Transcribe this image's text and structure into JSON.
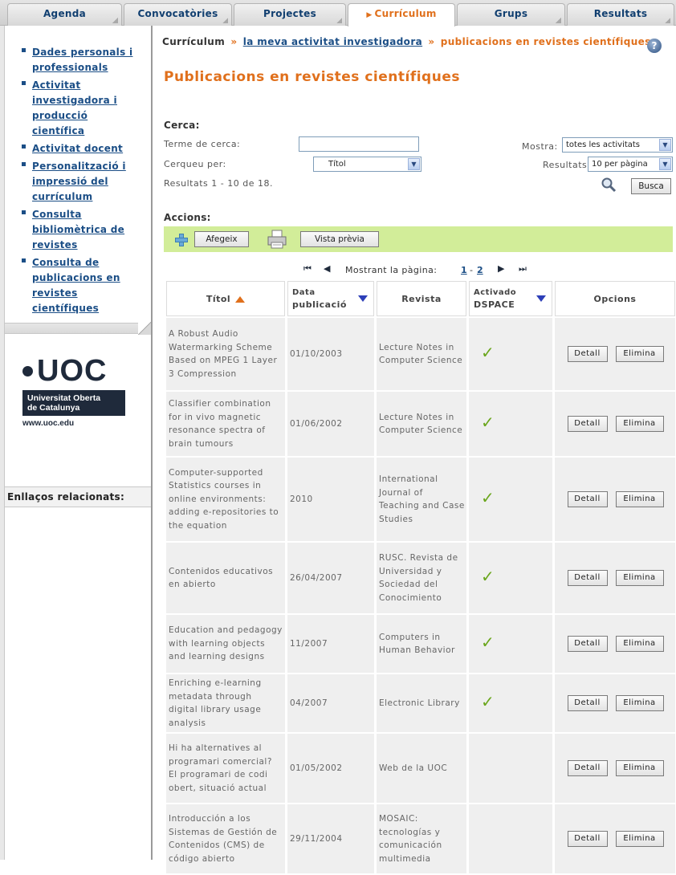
{
  "tabs": [
    {
      "label": "Agenda",
      "active": false
    },
    {
      "label": "Convocatòries",
      "active": false
    },
    {
      "label": "Projectes",
      "active": false
    },
    {
      "label": "Currículum",
      "active": true
    },
    {
      "label": "Grups",
      "active": false
    },
    {
      "label": "Resultats",
      "active": false
    }
  ],
  "sidebar": {
    "items": [
      "Dades personals i professionals",
      "Activitat investigadora i producció científica",
      "Activitat docent",
      "Personalització i impressió del currículum",
      "Consulta bibliomètrica de revistes",
      "Consulta de publicacions en revistes científiques"
    ],
    "logo_word": "UOC",
    "logo_box_line1": "Universitat Oberta",
    "logo_box_line2": "de Catalunya",
    "logo_url": "www.uoc.edu",
    "related_label": "Enllaços relacionats:"
  },
  "breadcrumb": {
    "root": "Currículum",
    "sep": "»",
    "link": "la meva activitat investigadora",
    "current": "publicacions en revistes científiques"
  },
  "help_icon": "?",
  "page_title": "Publicacions en revistes científiques",
  "search": {
    "heading": "Cerca:",
    "term_label": "Terme de cerca:",
    "term_value": "",
    "by_label": "Cerqueu per:",
    "by_value": "Títol",
    "results_text": "Resultats 1  - 10  de 18.",
    "mostra_label": "Mostra:",
    "mostra_value": "totes les activitats",
    "resultats_label": "Resultats",
    "resultats_value": "10 per pàgina",
    "button": "Busca"
  },
  "actions": {
    "heading": "Accions:",
    "add_button": "Afegeix",
    "preview_button": "Vista prèvia"
  },
  "pager": {
    "first": "⏮",
    "prev": "◀",
    "text": "Mostrant la pàgina:",
    "page1": "1",
    "dash": "-",
    "page2": "2",
    "next": "▶",
    "last": "⏭"
  },
  "table": {
    "headers": {
      "title": "Títol",
      "date_line1": "Data",
      "date_line2": "publicació",
      "journal": "Revista",
      "dspace_line1": "Activado",
      "dspace_line2": "DSPACE",
      "options": "Opcions"
    },
    "detail_button": "Detall",
    "delete_button": "Elimina",
    "check_glyph": "✓",
    "rows": [
      {
        "title": "A Robust Audio Watermarking Scheme Based on MPEG 1 Layer 3 Compression",
        "date": "01/10/2003",
        "journal": "Lecture Notes in Computer Science",
        "dspace": true
      },
      {
        "title": "Classifier combination for in vivo magnetic resonance spectra of brain tumours",
        "date": "01/06/2002",
        "journal": "Lecture Notes in Computer Science",
        "dspace": true
      },
      {
        "title": "Computer-supported Statistics courses in online environments: adding e-repositories to the equation",
        "date": "2010",
        "journal": "International Journal of Teaching and Case Studies",
        "dspace": true
      },
      {
        "title": "Contenidos educativos en abierto",
        "date": "26/04/2007",
        "journal": "RUSC. Revista de Universidad y Sociedad del Conocimiento",
        "dspace": true
      },
      {
        "title": "Education and pedagogy with learning objects and learning designs",
        "date": "11/2007",
        "journal": "Computers in Human Behavior",
        "dspace": true
      },
      {
        "title": "Enriching e-learning metadata through digital library usage analysis",
        "date": "04/2007",
        "journal": "Electronic Library",
        "dspace": true
      },
      {
        "title": "Hi ha alternatives al programari comercial? El programari de codi obert, situació actual",
        "date": "01/05/2002",
        "journal": "Web de la UOC",
        "dspace": false
      },
      {
        "title": "Introducción a los Sistemas de Gestión de Contenidos (CMS) de código abierto",
        "date": "29/11/2004",
        "journal": "MOSAIC: tecnologías y comunicación multimedia",
        "dspace": false
      }
    ]
  }
}
